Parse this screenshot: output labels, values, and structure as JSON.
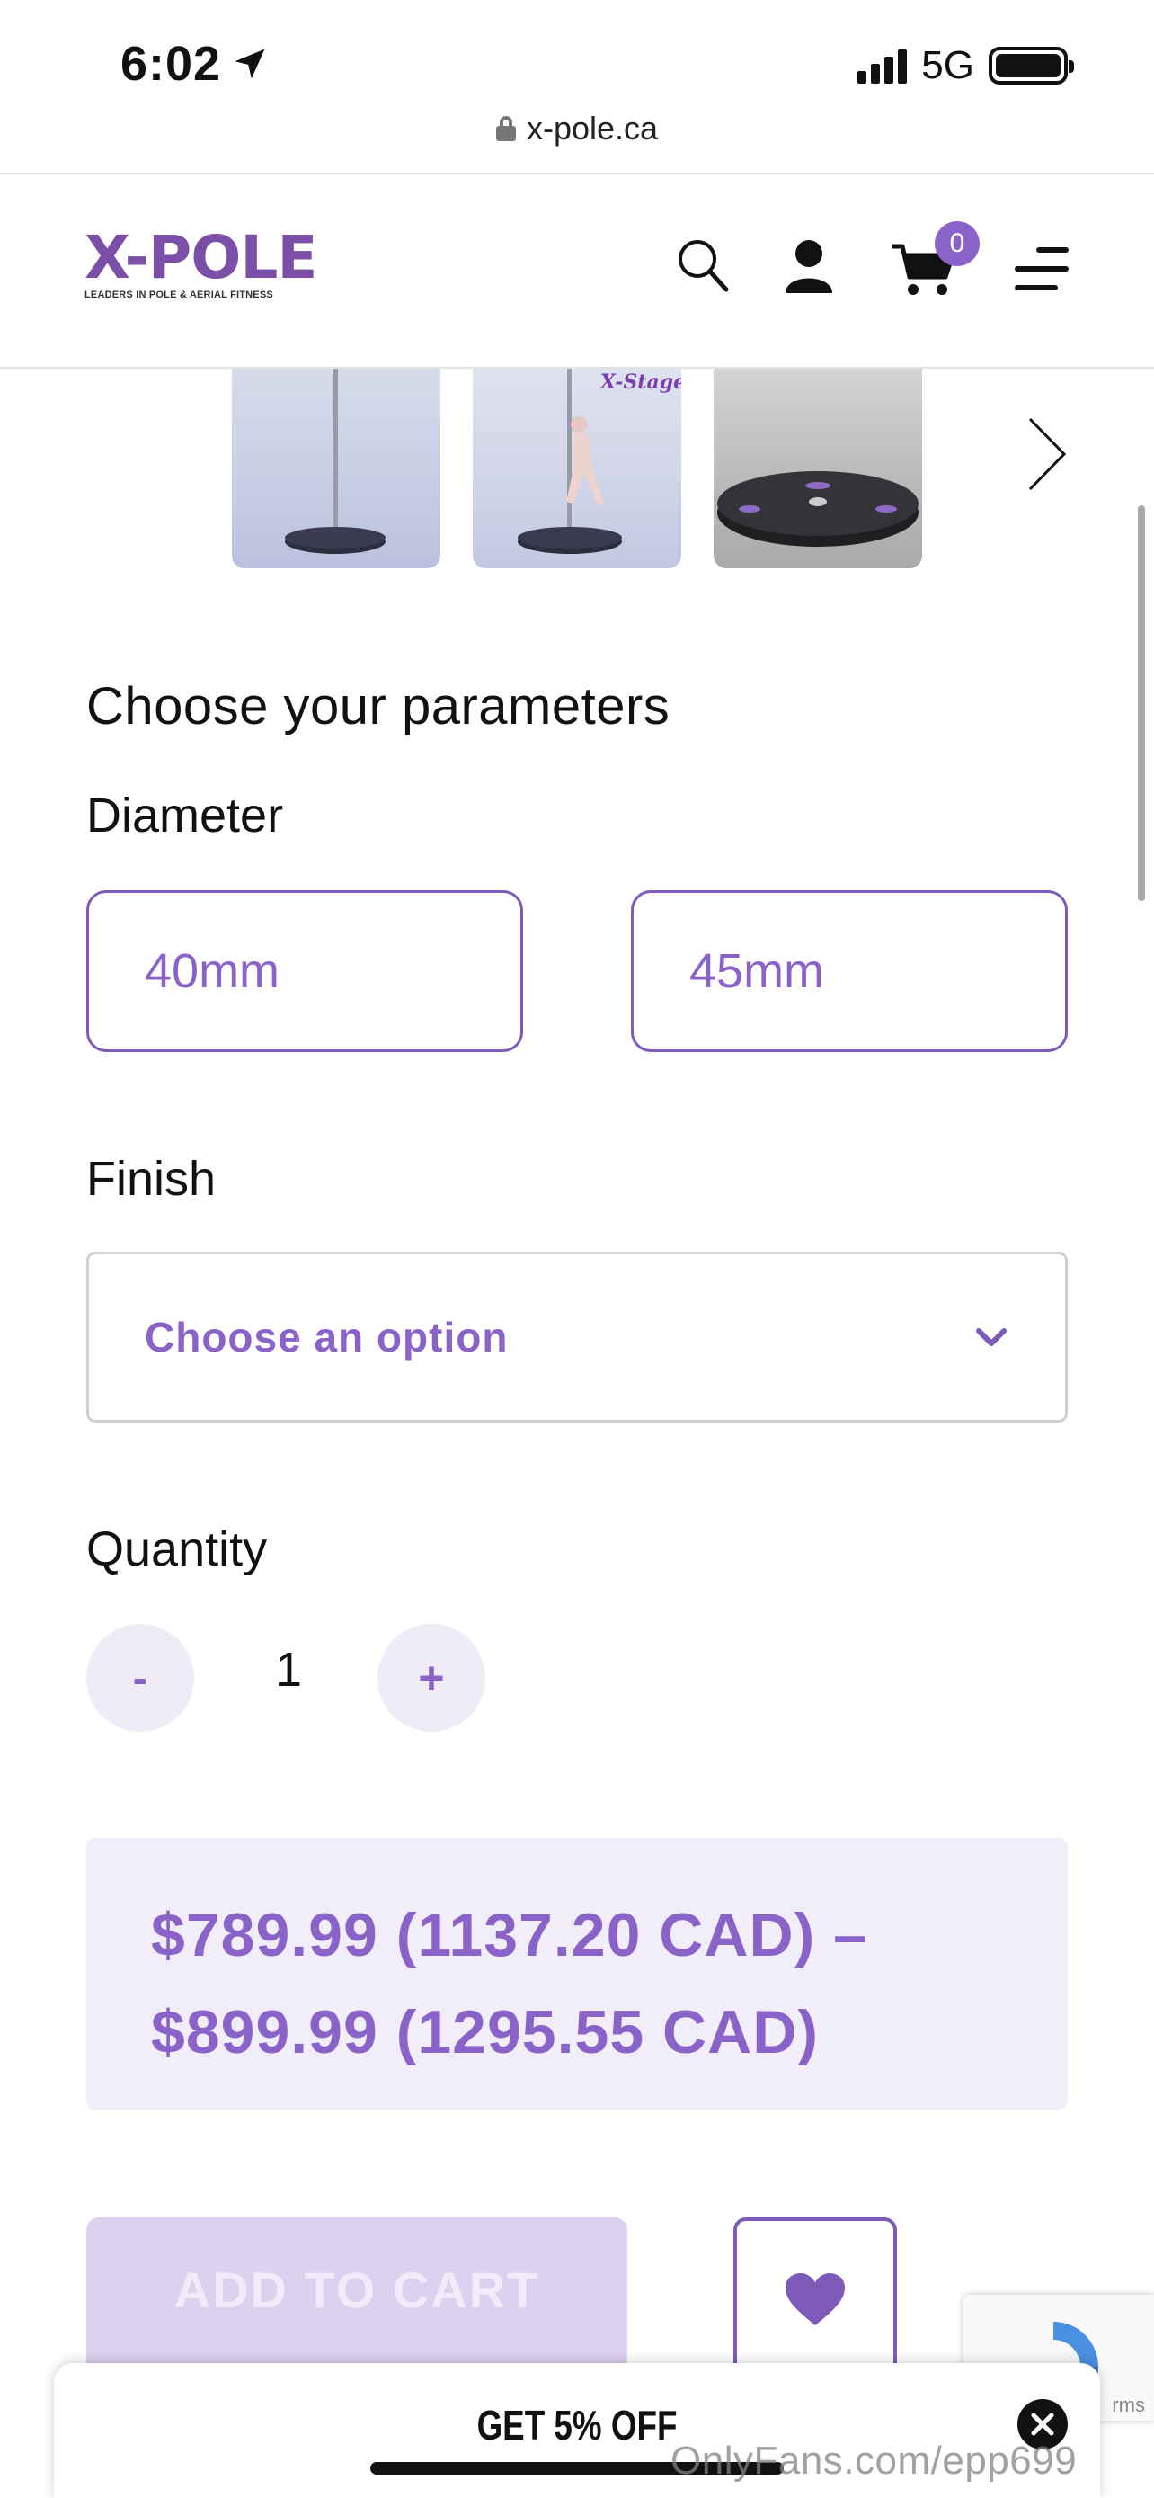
{
  "status_bar": {
    "time": "6:02",
    "network": "5G"
  },
  "browser": {
    "url": "x-pole.ca"
  },
  "header": {
    "logo_text": "X-POLE",
    "logo_tagline": "LEADERS IN POLE & AERIAL FITNESS",
    "cart_count": "0",
    "accent_color": "#8a63c9"
  },
  "gallery": {
    "thumbnails": [
      "pole-on-stage-thumbnail",
      "x-stage-dancer-thumbnail",
      "stage-platform-thumbnail"
    ],
    "thumb2_logo": "X-Stage"
  },
  "parameters": {
    "title": "Choose your parameters",
    "diameter_label": "Diameter",
    "diameter_options": [
      "40mm",
      "45mm"
    ],
    "finish_label": "Finish",
    "finish_placeholder": "Choose an option",
    "quantity_label": "Quantity",
    "quantity_value": "1",
    "qty_minus": "-",
    "qty_plus": "+"
  },
  "price": {
    "line1": "$789.99 (1137.20 CAD) –",
    "line2": "$899.99 (1295.55 CAD)"
  },
  "actions": {
    "add_to_cart": "ADD TO CART"
  },
  "recaptcha": {
    "text": "rms"
  },
  "promo": {
    "text": "GET 5% OFF"
  },
  "watermark": "OnlyFans.com/epp699"
}
